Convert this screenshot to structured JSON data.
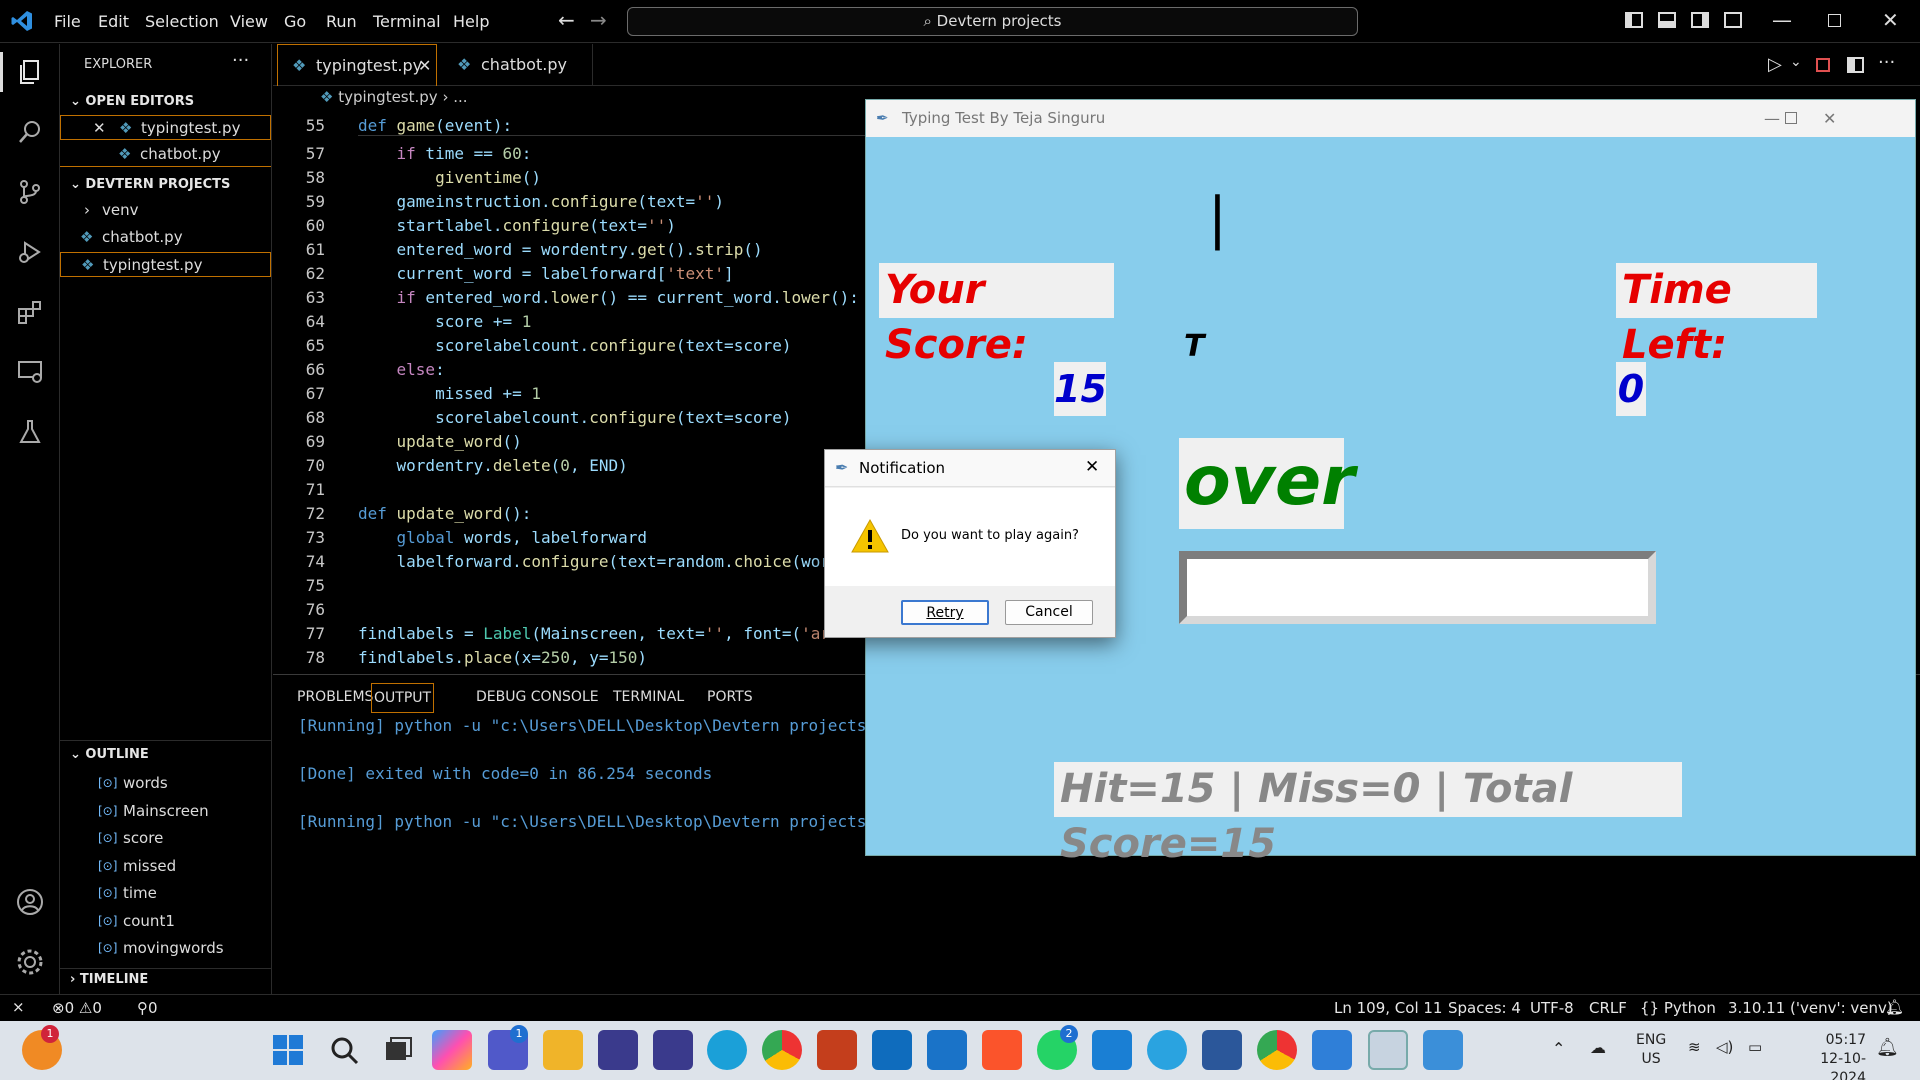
{
  "menu": [
    "File",
    "Edit",
    "Selection",
    "View",
    "Go",
    "Run",
    "Terminal",
    "Help"
  ],
  "search": {
    "text": "Devtern projects"
  },
  "sidebar": {
    "title": "EXPLORER",
    "open_editors_label": "OPEN EDITORS",
    "open_editors": [
      "typingtest.py",
      "chatbot.py"
    ],
    "project_label": "DEVTERN PROJECTS",
    "project_items": [
      "venv",
      "chatbot.py",
      "typingtest.py"
    ],
    "outline_label": "OUTLINE",
    "outline_items": [
      "words",
      "Mainscreen",
      "score",
      "missed",
      "time",
      "count1",
      "movingwords"
    ],
    "timeline_label": "TIMELINE"
  },
  "tabs": [
    {
      "label": "typingtest.py"
    },
    {
      "label": "chatbot.py"
    }
  ],
  "breadcrumb": {
    "file": "typingtest.py",
    "rest": "..."
  },
  "line_numbers": [
    "55",
    "57",
    "58",
    "59",
    "60",
    "61",
    "62",
    "63",
    "64",
    "65",
    "66",
    "67",
    "68",
    "69",
    "70",
    "71",
    "72",
    "73",
    "74",
    "75",
    "76",
    "77",
    "78"
  ],
  "panel": {
    "tabs": [
      "PROBLEMS",
      "OUTPUT",
      "DEBUG CONSOLE",
      "TERMINAL",
      "PORTS"
    ],
    "out1": "[Running] python -u \"c:\\Users\\DELL\\Desktop\\Devtern projects",
    "out2": "[Done] exited with code=0 in 86.254 seconds",
    "out3": "[Running] python -u \"c:\\Users\\DELL\\Desktop\\Devtern projects"
  },
  "status": {
    "errors": "0",
    "warnings": "0",
    "ports": "0",
    "position": "Ln 109, Col 11",
    "spaces": "Spaces: 4",
    "encoding": "UTF-8",
    "eol": "CRLF",
    "language": "Python",
    "interpreter": "3.10.11 ('venv': venv)"
  },
  "taskbar": {
    "lang1": "ENG",
    "lang2": "US",
    "time": "05:17",
    "date": "12-10-2024",
    "badge1": "1",
    "badge2": "1",
    "badge3": "2"
  },
  "app": {
    "title": "Typing Test By Teja Singuru",
    "cursor": "|",
    "score_label": "Your Score:",
    "time_label": "Time Left:",
    "moving_letter": "T",
    "score_value": "15",
    "time_value": "0",
    "word": "over",
    "summary": "Hit=15 | Miss=0 | Total Score=15"
  },
  "dialog": {
    "title": "Notification",
    "message": "Do you want to play again?",
    "retry": "Retry",
    "cancel": "Cancel"
  },
  "colors": {
    "score_red": "#e60000",
    "word_green": "#008000",
    "value_blue": "#0000cc",
    "app_bg": "#88cdec"
  }
}
